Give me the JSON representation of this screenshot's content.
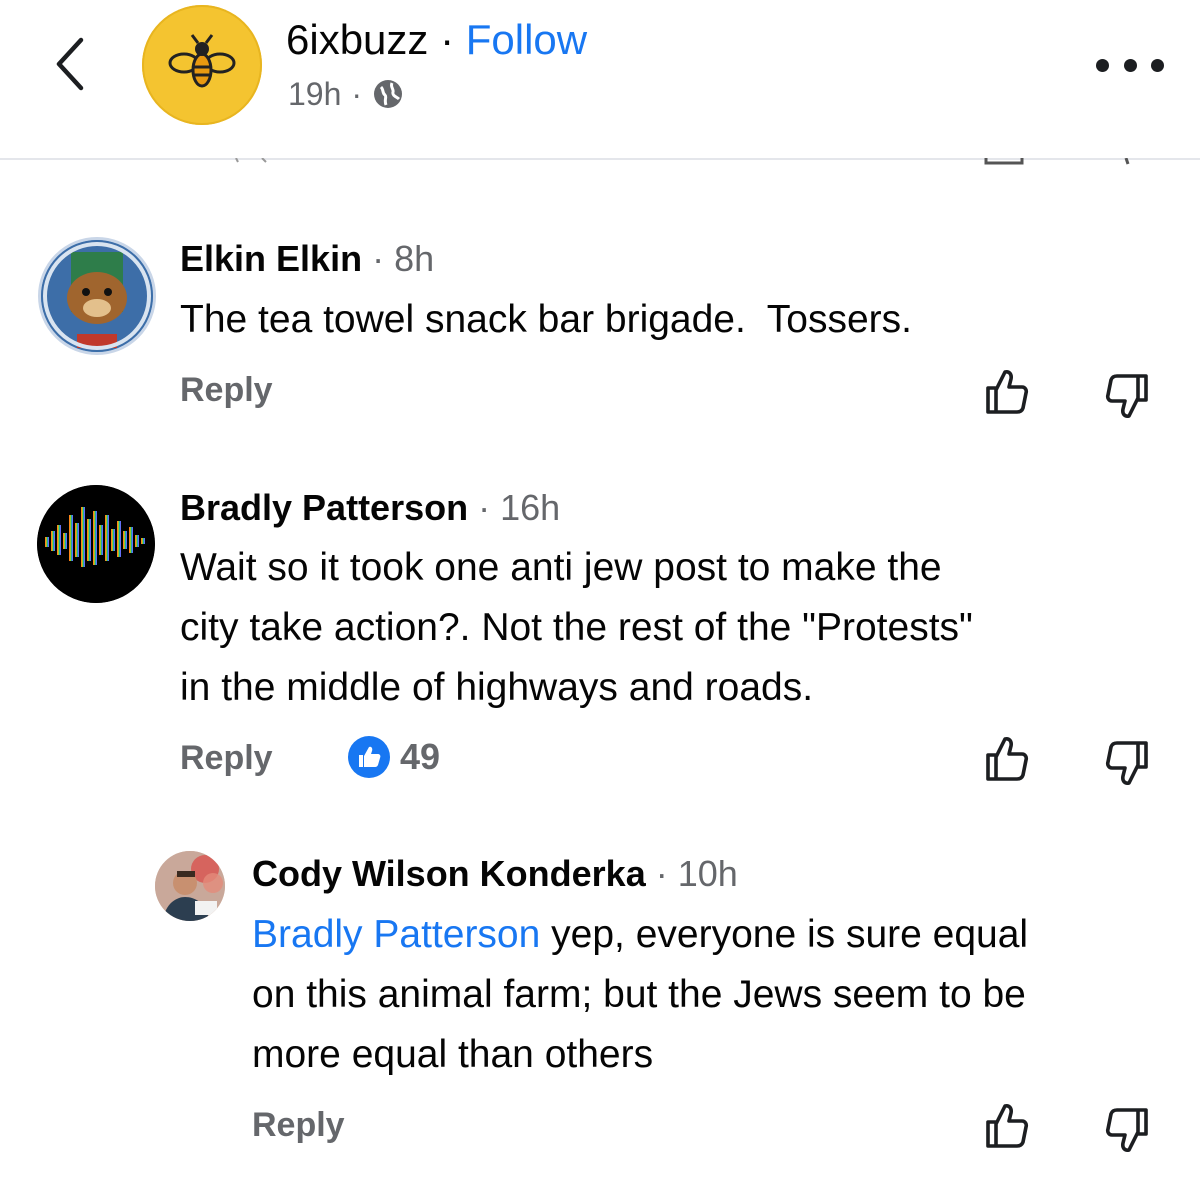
{
  "header": {
    "page_name": "6ixbuzz",
    "separator": "·",
    "follow_label": "Follow",
    "time": "19h",
    "meta_separator": "·",
    "audience_icon": "globe-icon"
  },
  "comments": [
    {
      "author": "Elkin Elkin",
      "separator": "·",
      "time": "8h",
      "text": "The tea towel snack bar brigade.  Tossers.",
      "reply_label": "Reply"
    },
    {
      "author": "Bradly Patterson",
      "separator": "·",
      "time": "16h",
      "text_lines": [
        "Wait so it took one anti jew post to make the",
        "city take action?. Not the rest of the \"Protests\"",
        "in the middle of highways and roads."
      ],
      "reply_label": "Reply",
      "reaction_count": "49",
      "reaction_icon": "like-badge-icon"
    },
    {
      "author": "Cody Wilson Konderka",
      "separator": "·",
      "time": "10h",
      "mention": "Bradly Patterson",
      "text_lines": [
        " yep, everyone is sure equal",
        "on this animal farm; but the Jews seem to be",
        "more equal than others"
      ],
      "reply_label": "Reply"
    }
  ],
  "colors": {
    "accent": "#1877f2",
    "secondary_text": "#65676b",
    "primary_text": "#050505",
    "page_avatar": "#f4c430"
  }
}
